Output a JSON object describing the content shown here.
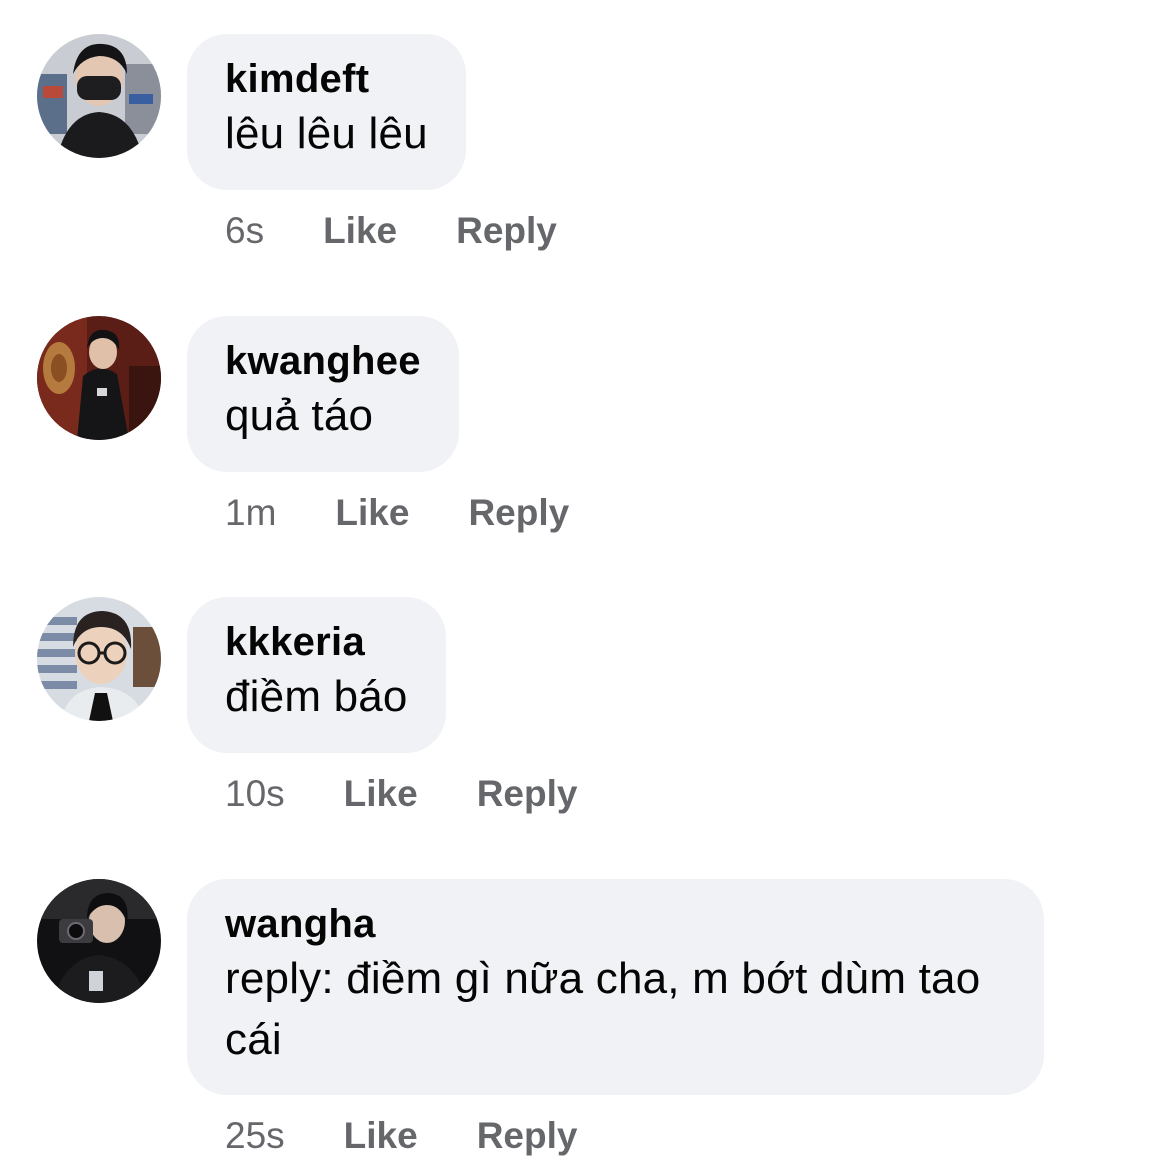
{
  "comments": [
    {
      "author": "kimdeft",
      "text": "lêu lêu lêu",
      "time": "6s",
      "like_label": "Like",
      "reply_label": "Reply",
      "avatar": "person-in-black-mask-icon"
    },
    {
      "author": "kwanghee",
      "text": "quả táo",
      "time": "1m",
      "like_label": "Like",
      "reply_label": "Reply",
      "avatar": "person-in-dark-room-icon"
    },
    {
      "author": "kkkeria",
      "text": "điềm báo",
      "time": "10s",
      "like_label": "Like",
      "reply_label": "Reply",
      "avatar": "person-with-glasses-icon"
    },
    {
      "author": "wangha",
      "text": "reply: điềm gì nữa cha, m bớt dùm tao cái",
      "time": "25s",
      "like_label": "Like",
      "reply_label": "Reply",
      "avatar": "person-with-camera-icon"
    }
  ],
  "colors": {
    "bubble": "#f0f2f5",
    "meta_text": "#65676b",
    "primary_text": "#050505"
  }
}
